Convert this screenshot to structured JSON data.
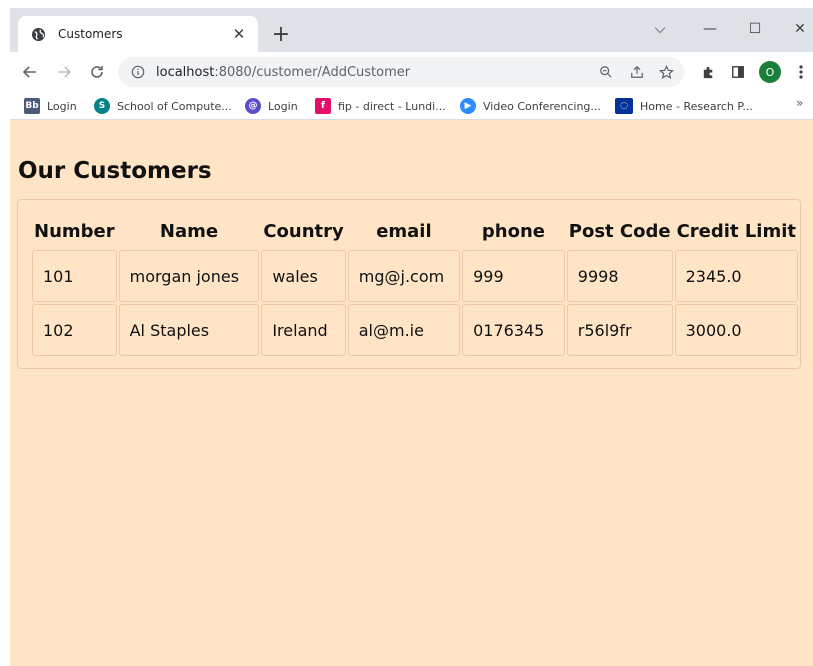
{
  "browser": {
    "tab": {
      "title": "Customers",
      "close_glyph": "✕"
    },
    "new_tab_glyph": "+",
    "window_controls": {
      "minimize": "—",
      "maximize": "☐",
      "close": "✕",
      "dropdown": "⌵"
    },
    "url": {
      "host": "localhost",
      "rest": ":8080/customer/AddCustomer"
    },
    "profile_initial": "O",
    "bookmarks": [
      {
        "label": "Login",
        "icon": "blackboard-icon",
        "color": "#4a5a78"
      },
      {
        "label": "School of Compute...",
        "icon": "sharepoint-icon",
        "color": "#038387"
      },
      {
        "label": "Login",
        "icon": "moodle-icon",
        "color": "#5b4fc9"
      },
      {
        "label": "fip - direct - Lundi...",
        "icon": "fip-icon",
        "color": "#e2106b"
      },
      {
        "label": "Video Conferencing...",
        "icon": "zoom-icon",
        "color": "#2d8cff"
      },
      {
        "label": "Home - Research P...",
        "icon": "eu-flag-icon",
        "color": "#003399"
      }
    ],
    "bookmarks_more": "»"
  },
  "page": {
    "title": "Our Customers",
    "table": {
      "headers": [
        "Number",
        "Name",
        "Country",
        "email",
        "phone",
        "Post Code",
        "Credit Limit"
      ],
      "rows": [
        [
          "101",
          "morgan jones",
          "wales",
          "mg@j.com",
          "999",
          "9998",
          "2345.0"
        ],
        [
          "102",
          "Al Staples",
          "Ireland",
          "al@m.ie",
          "0176345",
          "r56l9fr",
          "3000.0"
        ]
      ]
    }
  },
  "colors": {
    "page_bg": "#ffe4c6",
    "cell_border": "#efc8a3"
  }
}
